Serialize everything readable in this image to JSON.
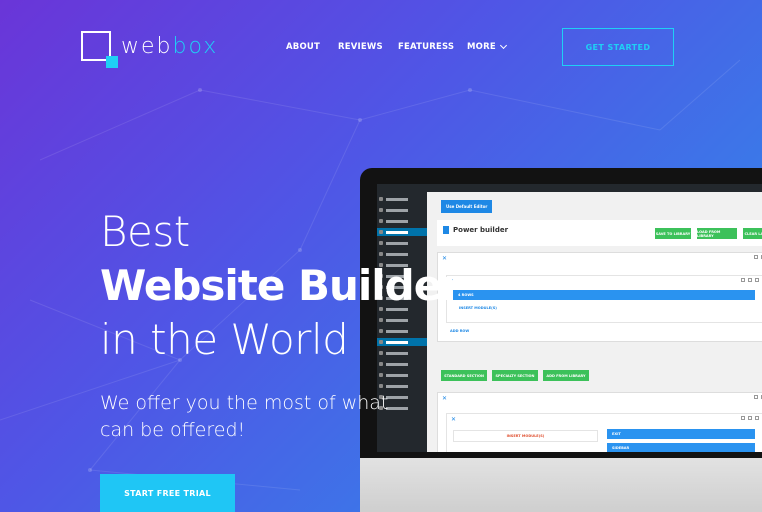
{
  "logo": {
    "part1": "web",
    "part2": "box"
  },
  "nav": {
    "items": [
      {
        "label": "ABOUT"
      },
      {
        "label": "REVIEWS"
      },
      {
        "label": "FEATURESS"
      },
      {
        "label": "MORE"
      }
    ],
    "cta": "GET STARTED"
  },
  "hero": {
    "line1": "Best",
    "line2": "Website Builder",
    "line3": "in the World",
    "subtitle": "We offer you the most of what can be offered!",
    "cta": "START FREE TRIAL"
  },
  "screen": {
    "default_editor_btn": "Use Default Editor",
    "builder_title": "Power builder",
    "header_buttons": [
      "SAVE TO LIBRARY",
      "LOAD FROM LIBRARY",
      "CLEAR LAYOUT"
    ],
    "row_labels": [
      "4 ROWS",
      "INSERT MODULE(S)",
      "ADD ROW"
    ],
    "section_buttons": [
      "STANDARD SECTION",
      "SPECIALTY SECTION",
      "ADD FROM LIBRARY"
    ],
    "row2_labels": [
      "INSERT MODULE(S)",
      "EXIT",
      "SIDEBAR"
    ]
  },
  "colors": {
    "accent": "#1fd0f5",
    "green": "#3cc15a",
    "blue": "#2a93f0"
  }
}
